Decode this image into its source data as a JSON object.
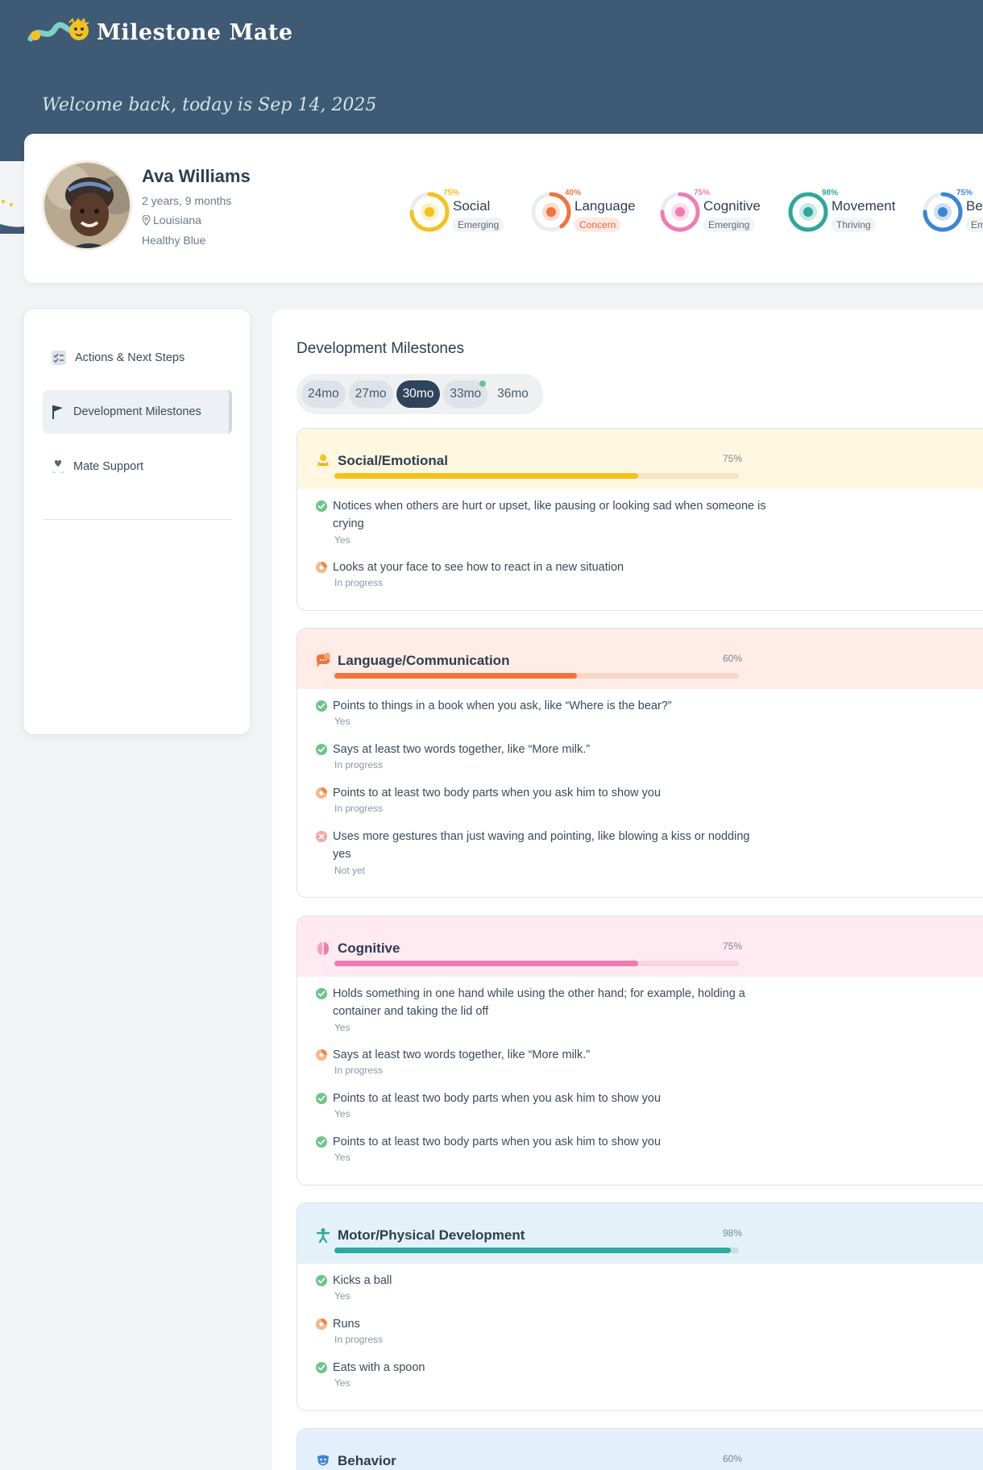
{
  "app": {
    "name": "Milestone Mate",
    "welcome": "Welcome back, today is Sep 14, 2025"
  },
  "child": {
    "name": "Ava Williams",
    "age": "2 years, 9 months",
    "location": "Louisiana",
    "plan": "Healthy Blue"
  },
  "domains": [
    {
      "pct": "75%",
      "label": "Social",
      "status": "Emerging",
      "color": "#f5c21b"
    },
    {
      "pct": "40%",
      "label": "Language",
      "status": "Concern",
      "color": "#f0743c"
    },
    {
      "pct": "75%",
      "label": "Cognitive",
      "status": "Emerging",
      "color": "#f17bb0"
    },
    {
      "pct": "98%",
      "label": "Movement",
      "status": "Thriving",
      "color": "#2ea89b"
    },
    {
      "pct": "75%",
      "label": "Behavi",
      "status": "Emergin",
      "color": "#3a86d6"
    }
  ],
  "domain_levels": [
    0.75,
    0.4,
    0.75,
    0.98,
    0.75
  ],
  "sidebar": {
    "items": [
      {
        "label": "Actions & Next Steps",
        "icon": "checklist-icon"
      },
      {
        "label": "Development Milestones",
        "icon": "flag-icon"
      },
      {
        "label": "Mate Support",
        "icon": "heart-hand-icon"
      }
    ]
  },
  "main": {
    "title": "Development Milestones",
    "age_tabs": [
      "24mo",
      "27mo",
      "30mo",
      "33mo",
      "36mo"
    ],
    "active_tab": "30mo",
    "sections": [
      {
        "title": "Social/Emotional",
        "pct": "75%",
        "level": 0.75,
        "header_bg": "#fff7e0",
        "track": "#fbe3c8",
        "fill": "#f5c21b",
        "icon": "social-icon",
        "items": [
          {
            "text": "Notices when others are hurt or upset, like pausing or looking sad when someone is crying",
            "status": "Yes",
            "state": "yes"
          },
          {
            "text": "Looks at your face to see how to react in a new situation",
            "status": "In progress",
            "state": "progress"
          }
        ]
      },
      {
        "title": "Language/Communication",
        "pct": "60%",
        "level": 0.6,
        "header_bg": "#ffece6",
        "track": "#f9d6c6",
        "fill": "#f0743c",
        "icon": "speech-bubble-icon",
        "items": [
          {
            "text": "Points to things in a book when you ask, like “Where is the bear?”",
            "status": "Yes",
            "state": "yes"
          },
          {
            "text": "Says at least two words together, like “More milk.”",
            "status": "In progress",
            "state": "yes"
          },
          {
            "text": "Points to at least two body parts when you ask him to show you",
            "status": "In progress",
            "state": "progress"
          },
          {
            "text": "Uses more gestures than just waving and pointing, like blowing a kiss or nodding yes",
            "status": "Not yet",
            "state": "no"
          }
        ]
      },
      {
        "title": "Cognitive",
        "pct": "75%",
        "level": 0.75,
        "header_bg": "#ffeaf1",
        "track": "#f9d3e1",
        "fill": "#f17bb0",
        "icon": "brain-icon",
        "items": [
          {
            "text": "Holds something in one hand while using the other hand; for example, holding a container and taking the lid off",
            "status": "Yes",
            "state": "yes"
          },
          {
            "text": "Says at least two words together, like “More milk.”",
            "status": "In progress",
            "state": "progress"
          },
          {
            "text": "Points to at least two body parts when you ask him to show you",
            "status": "Yes",
            "state": "yes"
          },
          {
            "text": "Points to at least two body parts when you ask him to show you",
            "status": "Yes",
            "state": "yes"
          }
        ]
      },
      {
        "title": "Motor/Physical Development",
        "pct": "98%",
        "level": 0.98,
        "header_bg": "#e3f1f8",
        "track": "#bfe3e0",
        "fill": "#2ea89b",
        "icon": "figure-icon",
        "items": [
          {
            "text": "Kicks a ball",
            "status": "Yes",
            "state": "yes"
          },
          {
            "text": "Runs",
            "status": "In progress",
            "state": "progress"
          },
          {
            "text": "Eats with a spoon",
            "status": "Yes",
            "state": "yes"
          }
        ]
      },
      {
        "title": "Behavior",
        "pct": "60%",
        "level": 0.6,
        "header_bg": "#e3f0fb",
        "track": "#cfe3f5",
        "fill": "#3a86d6",
        "icon": "mask-icon",
        "items": []
      }
    ]
  }
}
